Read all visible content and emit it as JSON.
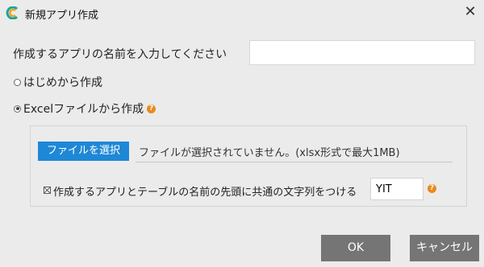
{
  "dialog": {
    "title": "新規アプリ作成",
    "close_symbol": "✕"
  },
  "form": {
    "name_label": "作成するアプリの名前を入力してください",
    "name_value": "",
    "option_scratch": {
      "label": "はじめから作成",
      "selected": false
    },
    "option_excel": {
      "label": "Excelファイルから作成",
      "selected": true
    },
    "help_symbol": "?",
    "excel": {
      "file_button": "ファイルを選択",
      "file_status": "ファイルが選択されていません。(xlsx形式で最大1MB)",
      "prefix_label": "作成するアプリとテーブルの名前の先頭に共通の文字列をつける",
      "prefix_checked": true,
      "prefix_value": "YIT"
    }
  },
  "buttons": {
    "ok": "OK",
    "cancel": "キャンセル"
  },
  "colors": {
    "primary": "#1e88d6",
    "help": "#e98a1c",
    "button_gray": "#757575",
    "background": "#ebebeb"
  },
  "icons": {
    "app": "app-logo-icon",
    "help": "question-icon",
    "close": "close-icon"
  }
}
